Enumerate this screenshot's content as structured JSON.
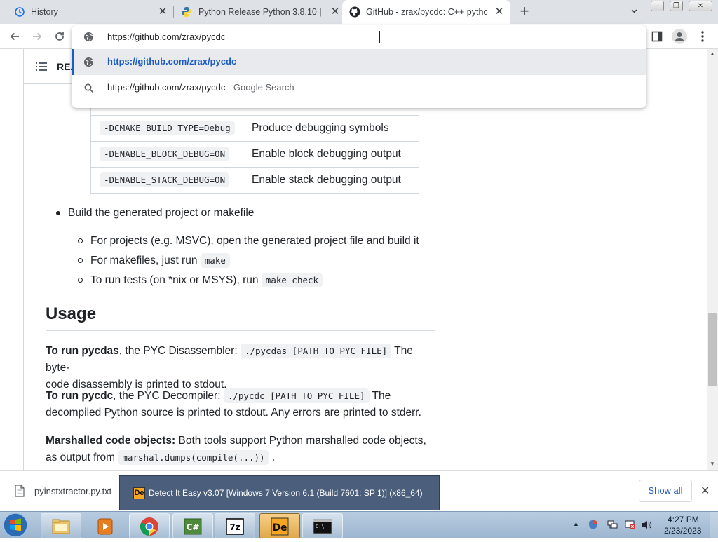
{
  "browser": {
    "tabs": [
      {
        "title": "History",
        "icon": "history-icon"
      },
      {
        "title": "Python Release Python 3.8.10 | Pyt",
        "icon": "python-icon"
      },
      {
        "title": "GitHub - zrax/pycdc: C++ python",
        "icon": "github-icon",
        "active": true
      }
    ],
    "new_tab_label": "+",
    "close_glyph": "✕",
    "tab_list_glyph": "⌄"
  },
  "omnibox": {
    "input_value": "https://github.com/zrax/pycdc",
    "suggestions": [
      {
        "text": "https://github.com/zrax/pycdc",
        "icon": "globe-icon",
        "highlighted": true
      },
      {
        "text": "https://github.com/zrax/pycdc",
        "suffix": " - Google Search",
        "icon": "search-icon"
      }
    ]
  },
  "page": {
    "toc_label": "README",
    "options_table": [
      {
        "option": "-DCMAKE_BUILD_TYPE=Debug",
        "description": "Produce debugging symbols"
      },
      {
        "option": "-DENABLE_BLOCK_DEBUG=ON",
        "description": "Enable block debugging output"
      },
      {
        "option": "-DENABLE_STACK_DEBUG=ON",
        "description": "Enable stack debugging output"
      }
    ],
    "build_item": "Build the generated project or makefile",
    "sub_items": {
      "projects": "For projects (e.g. MSVC), open the generated project file and build it",
      "makefiles": "For makefiles, just run ",
      "makefiles_code": "make",
      "tests": "To run tests (on *nix or MSYS), run ",
      "tests_code": "make check"
    },
    "usage_heading": "Usage",
    "pycdas": {
      "bold": "To run pycdas",
      "text1": ", the PYC Disassembler: ",
      "code": "./pycdas [PATH TO PYC FILE]",
      "text2": " The byte-",
      "line2": "code disassembly is printed to stdout."
    },
    "pycdc": {
      "bold": "To run pycdc",
      "text1": ", the PYC Decompiler: ",
      "code": "./pycdc [PATH TO PYC FILE]",
      "text2": " The",
      "line2": "decompiled Python source is printed to stdout. Any errors are printed to stderr."
    },
    "marshalled": {
      "bold": "Marshalled code objects:",
      "text1": " Both tools support Python marshalled code objects,",
      "line2": "as output from ",
      "code": "marshal.dumps(compile(...))",
      "text2": " ."
    }
  },
  "downloads": {
    "file_name": "pyinstxtractor.py.txt",
    "window_title": "Detect It Easy v3.07 [Windows 7 Version 6.1 (Build 7601: SP 1)] (x86_64)",
    "show_all": "Show all",
    "close_glyph": "✕"
  },
  "taskbar": {
    "apps": [
      "file-explorer",
      "media-player",
      "chrome",
      "csharp-tool",
      "7zip",
      "detect-it-easy",
      "command-prompt"
    ],
    "time": "4:27 PM",
    "date": "2/23/2023"
  },
  "colors": {
    "tab_strip": "#dee1e6",
    "highlight_row": "#e8eaed",
    "link_blue": "#1a5bc4",
    "taskbar": "#a9c0d8",
    "die_window": "#4b5f7c"
  }
}
